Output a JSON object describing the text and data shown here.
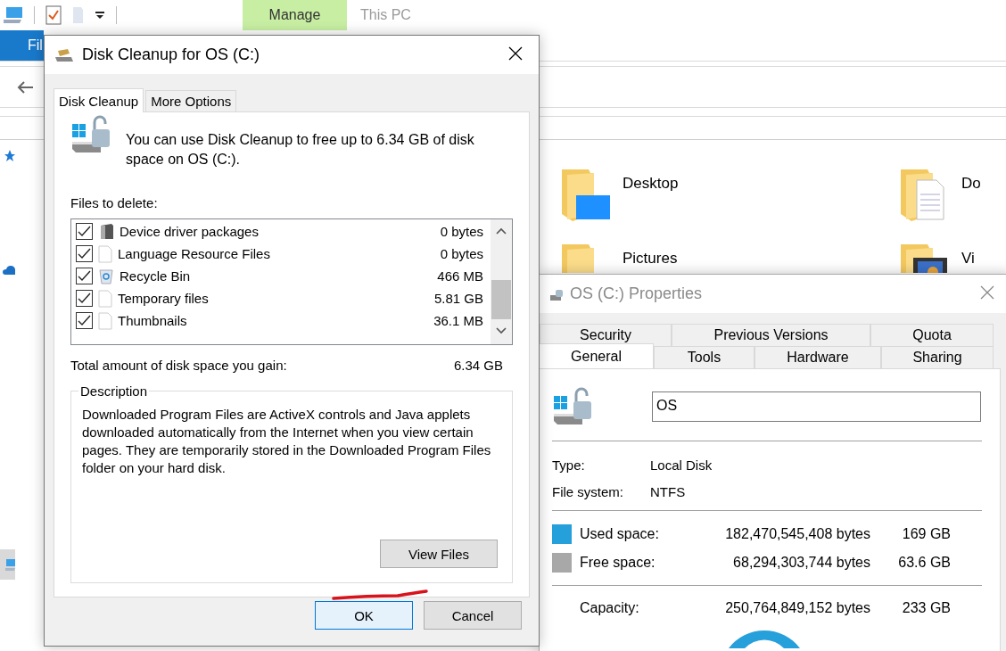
{
  "explorer": {
    "ribbon_tabs": [
      {
        "label": "Fil",
        "kind": "file"
      },
      {
        "label": "Manage",
        "kind": "contextual"
      },
      {
        "label": "This PC",
        "kind": "plain"
      }
    ],
    "nav_items": [
      {
        "kind": "quick-access",
        "selected": false
      },
      {
        "kind": "cloud",
        "selected": false
      },
      {
        "kind": "pc",
        "selected": true
      }
    ],
    "folders": [
      {
        "name": "Desktop",
        "kind": "desktop"
      },
      {
        "name": "Do",
        "kind": "documents"
      },
      {
        "name": "Pictures",
        "kind": "pictures"
      },
      {
        "name": "Vi",
        "kind": "videos"
      }
    ]
  },
  "properties": {
    "title": "OS (C:) Properties",
    "active": false,
    "tab_rows": [
      [
        {
          "label": "Security",
          "selected": false
        },
        {
          "label": "Previous Versions",
          "selected": false
        },
        {
          "label": "Quota",
          "selected": false
        }
      ],
      [
        {
          "label": "General",
          "selected": true
        },
        {
          "label": "Tools",
          "selected": false
        },
        {
          "label": "Hardware",
          "selected": false
        },
        {
          "label": "Sharing",
          "selected": false
        }
      ]
    ],
    "name_field": {
      "value": "OS"
    },
    "info": [
      {
        "label": "Type:",
        "value": "Local Disk"
      },
      {
        "label": "File system:",
        "value": "NTFS"
      }
    ],
    "space": [
      {
        "label": "Used space:",
        "bytes": "182,470,545,408 bytes",
        "size": "169 GB",
        "color": "#26a0da"
      },
      {
        "label": "Free space:",
        "bytes": "68,294,303,744 bytes",
        "size": "63.6 GB",
        "color": "#a8a8a8"
      }
    ],
    "capacity": {
      "label": "Capacity:",
      "bytes": "250,764,849,152 bytes",
      "size": "233 GB"
    }
  },
  "dialog": {
    "title": "Disk Cleanup for OS (C:)",
    "active": true,
    "tabs": [
      {
        "label": "Disk Cleanup",
        "selected": true
      },
      {
        "label": "More Options",
        "selected": false
      }
    ],
    "intro": "You can use Disk Cleanup to free up to 6.34 GB of disk space on OS (C:).",
    "files_label": "Files to delete:",
    "files": [
      {
        "name": "Device driver packages",
        "size": "0 bytes",
        "checked": true,
        "kind": "driver"
      },
      {
        "name": "Language Resource Files",
        "size": "0 bytes",
        "checked": true,
        "kind": "file"
      },
      {
        "name": "Recycle Bin",
        "size": "466 MB",
        "checked": true,
        "kind": "recycle"
      },
      {
        "name": "Temporary files",
        "size": "5.81 GB",
        "checked": true,
        "kind": "file"
      },
      {
        "name": "Thumbnails",
        "size": "36.1 MB",
        "checked": true,
        "kind": "file"
      }
    ],
    "total": {
      "label": "Total amount of disk space you gain:",
      "value": "6.34 GB"
    },
    "description": {
      "legend": "Description",
      "text": "Downloaded Program Files are ActiveX controls and Java applets downloaded automatically from the Internet when you view certain pages. They are temporarily stored in the Downloaded Program Files folder on your hard disk.",
      "button": "View Files"
    },
    "buttons": [
      {
        "label": "OK",
        "default": true
      },
      {
        "label": "Cancel",
        "default": false
      }
    ]
  }
}
